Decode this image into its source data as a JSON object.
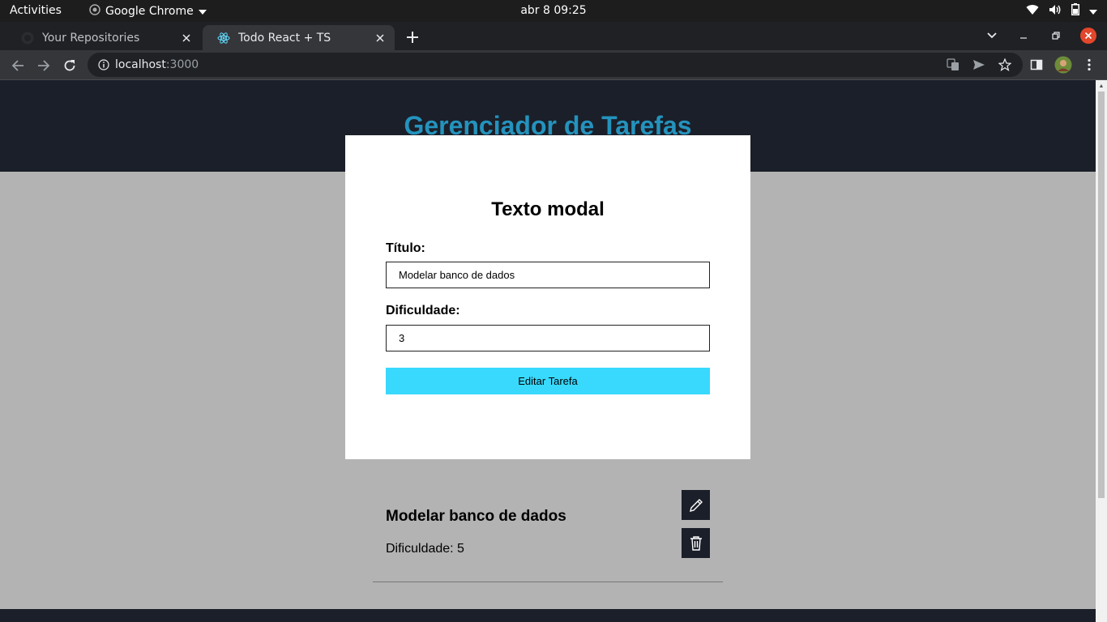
{
  "os_bar": {
    "activities": "Activities",
    "app_name": "Google Chrome",
    "clock": "abr 8  09:25"
  },
  "browser": {
    "tabs": [
      {
        "label": "Your Repositories",
        "active": false
      },
      {
        "label": "Todo React + TS",
        "active": true
      }
    ],
    "address": {
      "host": "localhost",
      "port": ":3000"
    },
    "colors": {
      "close_button": "#e2462b",
      "tab_active": "#35363a",
      "tab_strip": "#202124"
    }
  },
  "app": {
    "title": "Gerenciador de Tarefas",
    "colors": {
      "header_bg": "#1b1f29",
      "title": "#2493bd",
      "overlay": "#b3b3b3"
    }
  },
  "modal": {
    "heading": "Texto modal",
    "title_label": "Título:",
    "title_value": "Modelar banco de dados",
    "difficulty_label": "Dificuldade:",
    "difficulty_value": "3",
    "submit_label": "Editar Tarefa",
    "colors": {
      "submit_bg": "#38d9fd"
    }
  },
  "tasks": [
    {
      "title": "Modelar banco de dados",
      "difficulty_text": "Dificuldade: 5",
      "edit_icon": "pencil-icon",
      "delete_icon": "trash-icon"
    }
  ]
}
